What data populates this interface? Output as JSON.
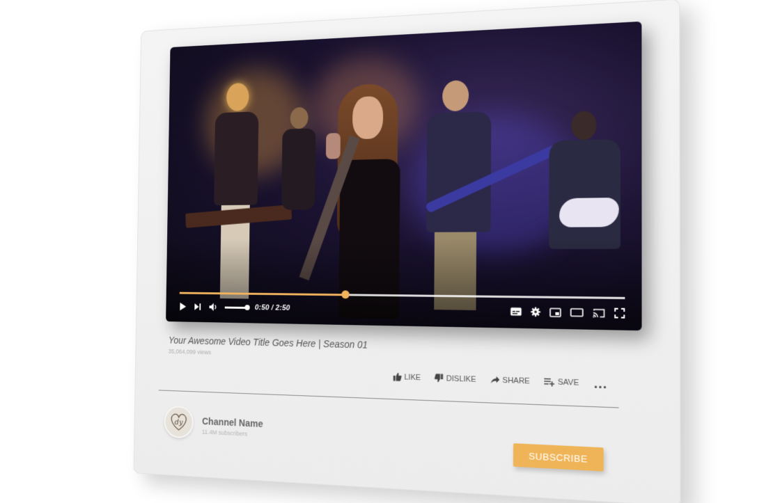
{
  "player": {
    "current_time": "0:50",
    "duration": "2:50",
    "time_display": "0:50 / 2:50",
    "progress_fraction": 0.4,
    "volume_fraction": 1.0,
    "accent_color": "#f1b35d"
  },
  "video": {
    "title": "Your Awesome Video Title Goes Here | Season 01",
    "views": "35,064,099 views"
  },
  "actions": {
    "like": "LIKE",
    "dislike": "DISLIKE",
    "share": "SHARE",
    "save": "SAVE",
    "more": "..."
  },
  "channel": {
    "name": "Channel Name",
    "subscribers": "11.4M subscribers",
    "avatar_initials": "dy"
  },
  "subscribe": {
    "label": "SUBSCRIBE",
    "color": "#efb457"
  },
  "icons": [
    "play-icon",
    "skip-next-icon",
    "volume-icon",
    "subtitles-icon",
    "settings-icon",
    "miniplayer-icon",
    "theater-mode-icon",
    "cast-icon",
    "fullscreen-icon",
    "thumbs-up-icon",
    "thumbs-down-icon",
    "share-icon",
    "playlist-add-icon"
  ]
}
